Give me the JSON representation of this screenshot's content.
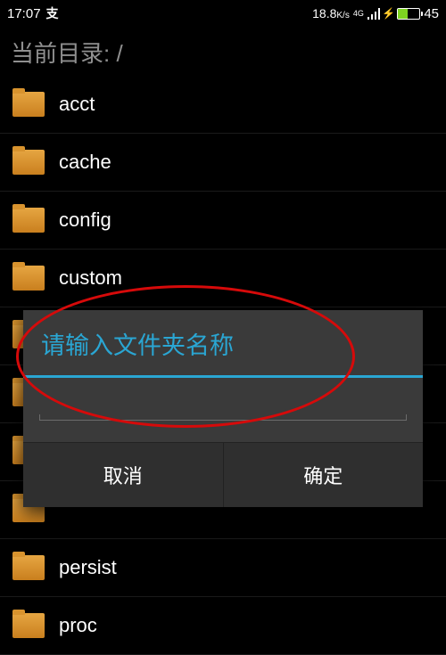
{
  "statusbar": {
    "time": "17:07",
    "net_speed": "18.8",
    "net_speed_unit": "K/s",
    "net_type": "4G",
    "battery_pct": "45"
  },
  "path": {
    "label": "当前目录: /"
  },
  "files": [
    {
      "name": "acct"
    },
    {
      "name": "cache"
    },
    {
      "name": "config"
    },
    {
      "name": "custom"
    },
    {
      "name": ""
    },
    {
      "name": ""
    },
    {
      "name": ""
    },
    {
      "name": ""
    },
    {
      "name": "persist"
    },
    {
      "name": "proc"
    }
  ],
  "dialog": {
    "title": "请输入文件夹名称",
    "input_value": "",
    "cancel": "取消",
    "ok": "确定"
  }
}
